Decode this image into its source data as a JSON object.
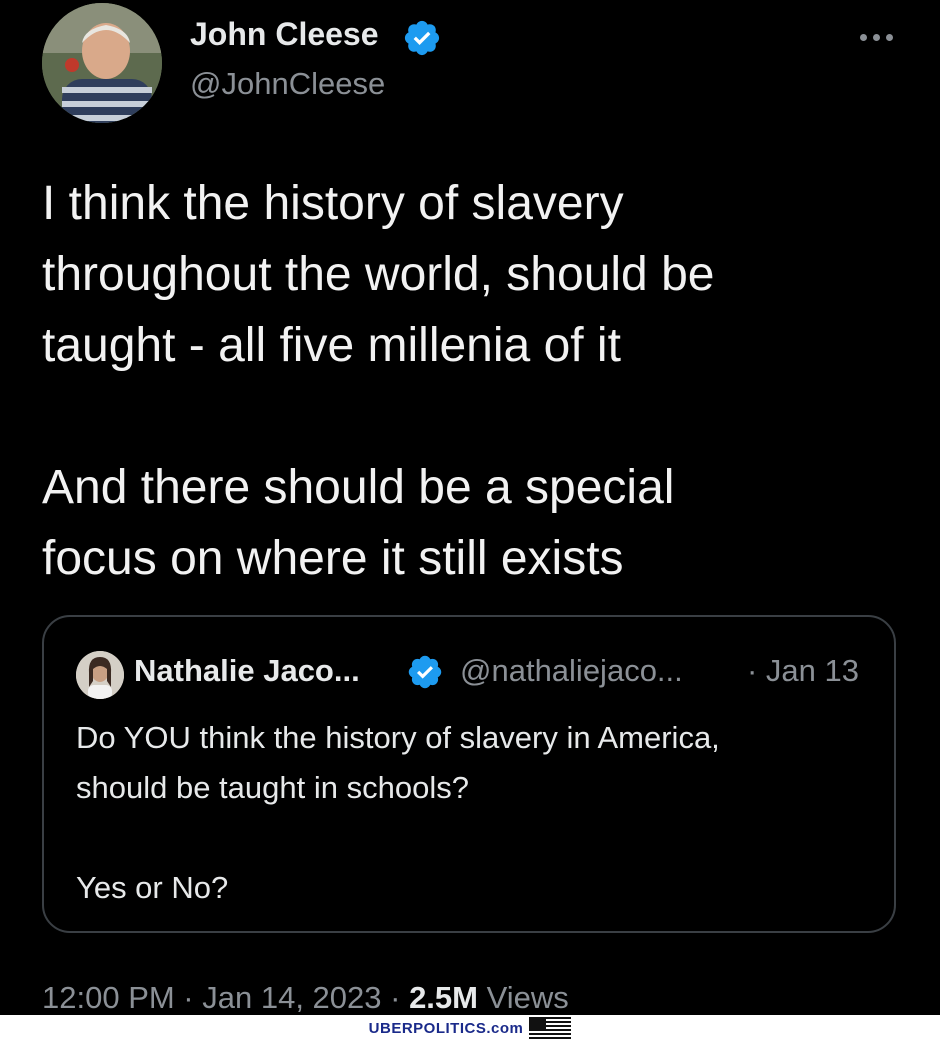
{
  "tweet": {
    "author_name": "John Cleese",
    "author_handle": "@JohnCleese",
    "text": "I think the history of slavery\nthroughout the world, should be\ntaught - all five millenia of it\n\nAnd there should be a special\nfocus on where it still exists",
    "timestamp": "12:00 PM · Jan 14, 2023 · ",
    "views_count": "2.5M",
    "views_label": " Views"
  },
  "quoted_tweet": {
    "author_name": "Nathalie Jaco...",
    "author_handle": "@nathaliejaco...",
    "date": "· Jan 13",
    "text": "Do YOU think the history of slavery in America,\nshould be taught in schools?\n\nYes or No?"
  },
  "watermark": {
    "text": "UBERPOLITICS.com"
  },
  "colors": {
    "background": "#000000",
    "verified_blue": "#1d9bf0",
    "secondary_text": "#8b9096",
    "primary_text": "#e7e9ea",
    "border": "#3a3f44"
  },
  "icons": {
    "verified": "verified-badge-icon",
    "more": "more-options-icon",
    "flag": "us-flag-icon"
  }
}
